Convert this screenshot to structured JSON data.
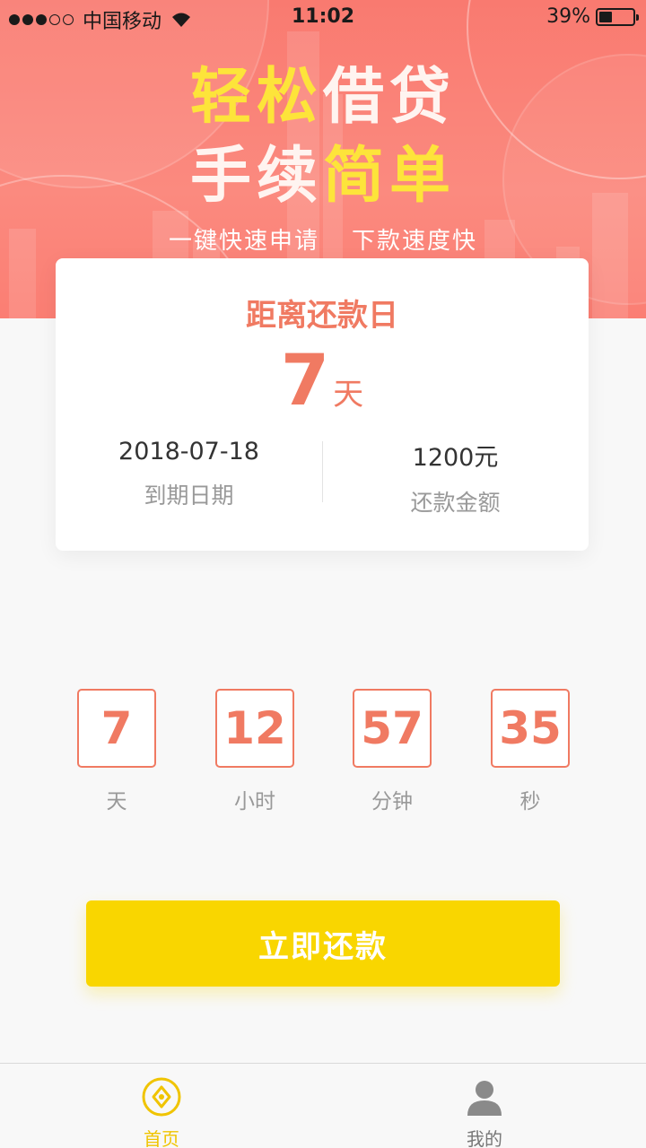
{
  "status_bar": {
    "carrier": "中国移动",
    "time": "11:02",
    "battery": "39%",
    "battery_level": 0.39
  },
  "banner": {
    "line1_highlight": "轻松",
    "line1_rest": "借贷",
    "line2_rest": "手续",
    "line2_highlight": "简单",
    "tagline_left": "一键快速申请",
    "tagline_right": "下款速度快"
  },
  "repayment_card": {
    "title": "距离还款日",
    "days_value": "7",
    "days_unit": "天",
    "due_date": "2018-07-18",
    "due_date_label": "到期日期",
    "amount": "1200元",
    "amount_label": "还款金额"
  },
  "countdown": [
    {
      "value": "7",
      "label": "天"
    },
    {
      "value": "12",
      "label": "小时"
    },
    {
      "value": "57",
      "label": "分钟"
    },
    {
      "value": "35",
      "label": "秒"
    }
  ],
  "repay_button": "立即还款",
  "tabbar": {
    "home": "首页",
    "mine": "我的"
  },
  "colors": {
    "brand_coral": "#f07a62",
    "brand_yellow": "#f9d600",
    "banner_bg": "#f97a70"
  },
  "icons": {
    "home_tab": "coin-icon",
    "mine_tab": "user-icon"
  }
}
